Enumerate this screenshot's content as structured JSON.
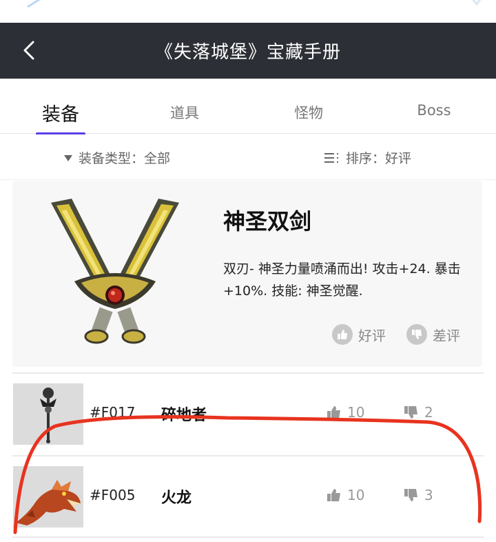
{
  "header": {
    "title": "《失落城堡》宝藏手册",
    "back_icon": "chevron-left-icon"
  },
  "tabs": [
    {
      "label": "装备",
      "active": true
    },
    {
      "label": "道具",
      "active": false
    },
    {
      "label": "怪物",
      "active": false
    },
    {
      "label": "Boss",
      "active": false
    }
  ],
  "filters": {
    "type": {
      "label": "装备类型：全部",
      "icon": "triangle-down-icon"
    },
    "sort": {
      "label": "排序：好评",
      "icon": "sort-list-icon"
    }
  },
  "featured": {
    "name": "神圣双剑",
    "description": "双刃- 神圣力量喷涌而出! 攻击+24. 暴击+10%. 技能: 神圣觉醒.",
    "like_label": "好评",
    "dislike_label": "差评",
    "image_icon": "twin-swords-icon"
  },
  "items": [
    {
      "code": "#F017",
      "name": "碎地者",
      "likes": "10",
      "dislikes": "2",
      "image_icon": "staff-icon"
    },
    {
      "code": "#F005",
      "name": "火龙",
      "likes": "10",
      "dislikes": "3",
      "image_icon": "fire-dragon-icon"
    }
  ],
  "colors": {
    "appbar": "#2c2f35",
    "tab_indicator": "#5b3fe6",
    "annotation_stroke": "#e8331f"
  }
}
